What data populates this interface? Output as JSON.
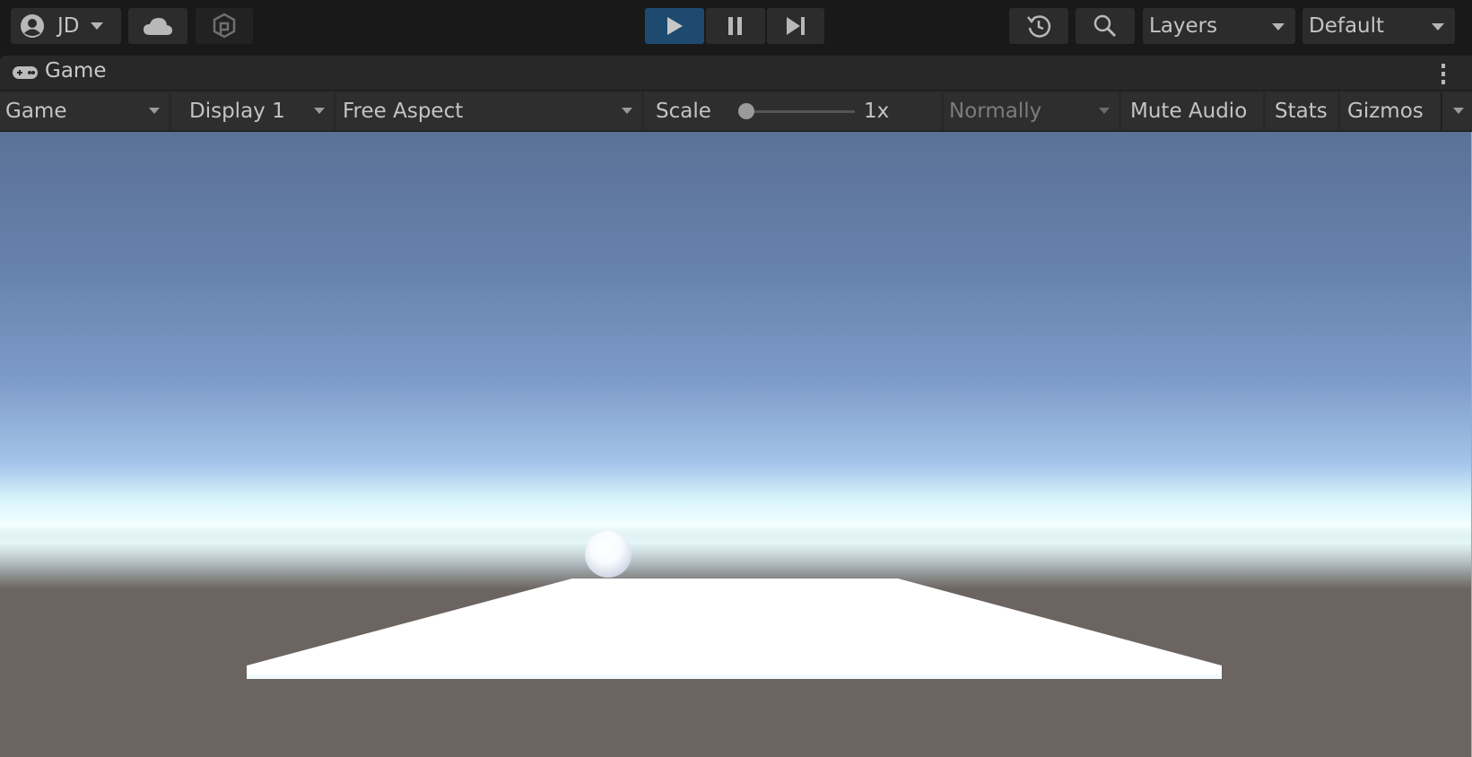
{
  "topbar": {
    "account_label": "JD",
    "account_icon": "account-circle-icon",
    "cloud_icon": "cloud-icon",
    "plastic_scm_icon": "plastic-scm-icon",
    "play_icon": "play-icon",
    "pause_icon": "pause-icon",
    "step_icon": "step-icon",
    "history_icon": "undo-history-icon",
    "search_icon": "search-icon",
    "layers_label": "Layers",
    "layout_label": "Default",
    "colors": {
      "play_active": "#1f4a70"
    }
  },
  "game_tab": {
    "title": "Game",
    "icon": "gamepad-icon",
    "more_icon": "kebab-menu-icon"
  },
  "game_toolbar": {
    "view_select": "Game",
    "display_select": "Display 1",
    "aspect_select": "Free Aspect",
    "scale_label": "Scale",
    "scale_value": "1x",
    "scale_slider_fraction": 0,
    "play_mode_select": "Normally",
    "mute_audio_label": "Mute Audio",
    "stats_label": "Stats",
    "gizmos_label": "Gizmos"
  },
  "scene": {
    "objects": [
      "sphere",
      "plane"
    ],
    "sky_top_color": "#5b7197",
    "horizon_color": "#f4ffff",
    "ground_color": "#6a625e"
  }
}
